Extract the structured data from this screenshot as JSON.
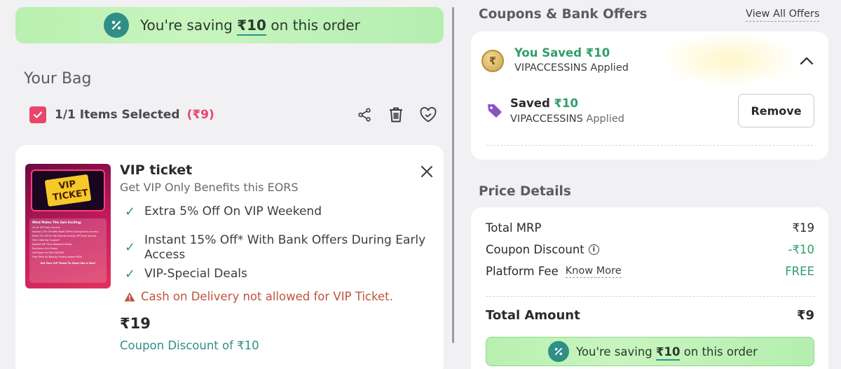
{
  "top_banner": {
    "prefix": "You're saving",
    "amount": "₹10",
    "suffix": "on this order"
  },
  "bag": {
    "title": "Your Bag",
    "selected_label": "1/1 Items Selected",
    "selected_total": "(₹9)"
  },
  "item": {
    "name": "VIP ticket",
    "subtitle": "Get VIP Only Benefits this EORS",
    "thumb_title": "VIP TICKET",
    "thumb_heading": "What Makes This Sale Exciting:",
    "thumb_lines": [
      "24-Hr VIP Early Access",
      "Instant 15% Off With Bank Offers During Early Access",
      "Extra 5% Off On Top Brands During VIP Early Access",
      "Free Clearing Coupon*",
      "Special VIP Only Weekend Deals",
      "Exclusive A-Hr Deals",
      "Get Items At Flat ₹49/₹99",
      "Free Gifts On Beauty Orders Above ₹500"
    ],
    "thumb_footer": "Get Your VIP Ticket To Shop Like A Star!",
    "features": [
      {
        "line1": "Extra 5% Off On VIP Weekend",
        "line2": ""
      },
      {
        "line1": "Instant 15% Off* With Bank Offers During Early",
        "line2": "Access"
      },
      {
        "line1": "VIP-Special Deals",
        "line2": ""
      }
    ],
    "warning": "Cash on Delivery not allowed for VIP Ticket.",
    "price": "₹19",
    "coupon_discount": "Coupon Discount of ₹10"
  },
  "coupons": {
    "title": "Coupons & Bank Offers",
    "view_all": "View All Offers",
    "saved_title": "You Saved ₹10",
    "saved_code": "VIPACCESSINS Applied",
    "applied_saved_label": "Saved",
    "applied_saved_amount": "₹10",
    "applied_code": "VIPACCESSINS",
    "applied_suffix": "Applied",
    "remove_label": "Remove"
  },
  "price_details": {
    "title": "Price Details",
    "rows": [
      {
        "label": "Total MRP",
        "value": "₹19"
      },
      {
        "label": "Coupon Discount",
        "value": "-₹10"
      },
      {
        "label": "Platform Fee",
        "link": "Know More",
        "value": "FREE"
      }
    ],
    "total_label": "Total Amount",
    "total_value": "₹9"
  },
  "bottom_banner": {
    "prefix": "You're saving",
    "amount": "₹10",
    "suffix": "on this order"
  },
  "colors": {
    "accent_pink": "#e8456b",
    "teal": "#2f8f86",
    "green_text": "#2e9e6b",
    "warning": "#c0533f"
  }
}
